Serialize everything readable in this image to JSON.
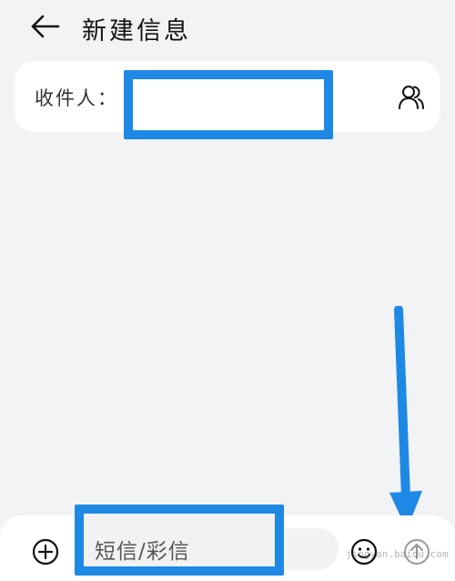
{
  "header": {
    "back_icon": "arrow-left-icon",
    "title": "新建信息"
  },
  "recipient": {
    "label": "收件人：",
    "input_value": "",
    "contacts_icon": "contacts-icon"
  },
  "composer": {
    "add_icon": "plus-circle-icon",
    "placeholder": "短信/彩信",
    "emoji_icon": "emoji-icon",
    "send_icon": "send-arrow-up-icon"
  },
  "annotations": {
    "highlight_color": "#1e88e5"
  },
  "watermark": "jingyan.baidu.com"
}
